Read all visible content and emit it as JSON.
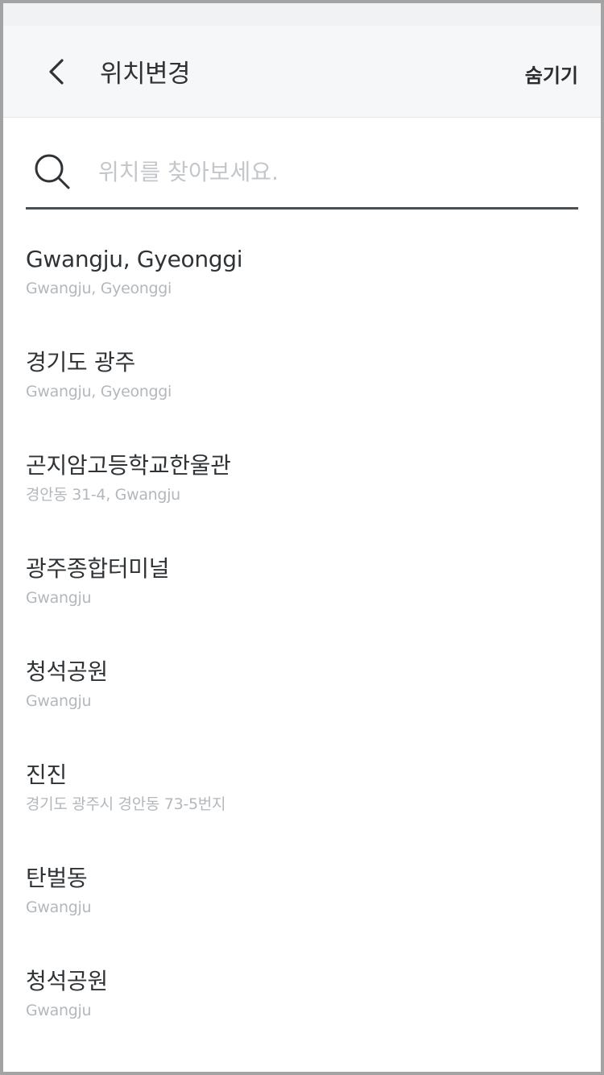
{
  "header": {
    "title": "위치변경",
    "hide_label": "숨기기"
  },
  "search": {
    "placeholder": "위치를 찾아보세요.",
    "value": ""
  },
  "results": [
    {
      "title": "Gwangju, Gyeonggi",
      "subtitle": "Gwangju, Gyeonggi"
    },
    {
      "title": "경기도 광주",
      "subtitle": "Gwangju, Gyeonggi"
    },
    {
      "title": "곤지암고등학교한울관",
      "subtitle": "경안동 31-4, Gwangju"
    },
    {
      "title": "광주종합터미널",
      "subtitle": "Gwangju"
    },
    {
      "title": "청석공원",
      "subtitle": "Gwangju"
    },
    {
      "title": "진진",
      "subtitle": "경기도 광주시 경안동 73-5번지"
    },
    {
      "title": "탄벌동",
      "subtitle": "Gwangju"
    },
    {
      "title": "청석공원",
      "subtitle": "Gwangju"
    }
  ],
  "icons": {
    "back": "chevron-left-icon",
    "search": "search-icon"
  },
  "colors": {
    "header_bg": "#f6f7f8",
    "title_text": "#2f3336",
    "subtitle_text": "#b3b8bc",
    "search_underline": "#4a5156"
  }
}
